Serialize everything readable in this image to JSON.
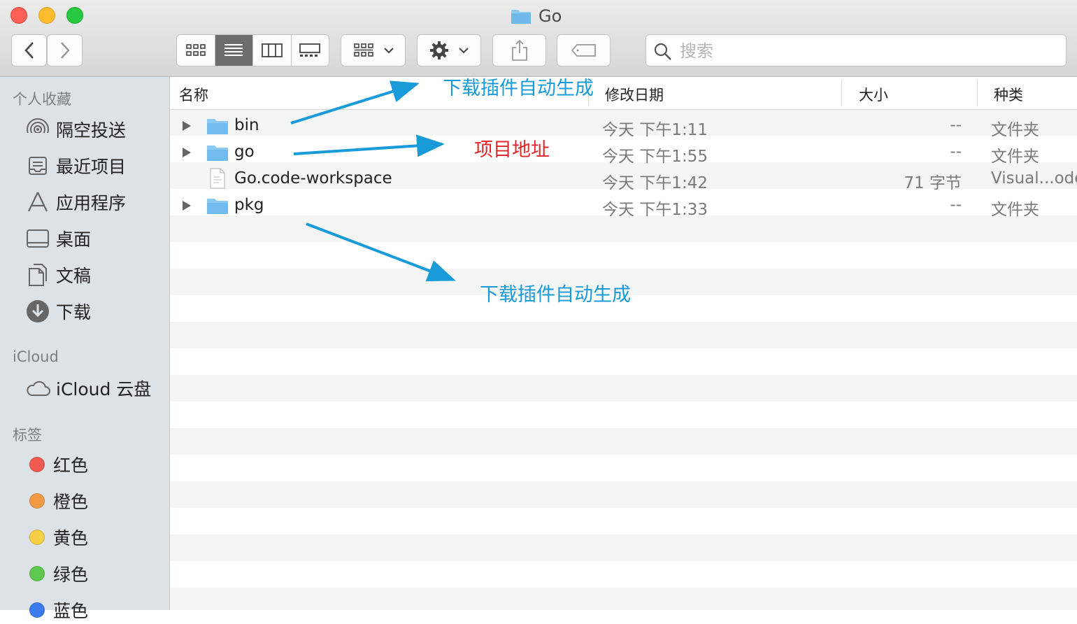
{
  "window": {
    "title": "Go"
  },
  "search": {
    "placeholder": "搜索"
  },
  "sidebar": {
    "favorites_header": "个人收藏",
    "favorites": [
      {
        "label": "隔空投送",
        "icon": "airdrop-icon"
      },
      {
        "label": "最近项目",
        "icon": "recents-icon"
      },
      {
        "label": "应用程序",
        "icon": "applications-icon"
      },
      {
        "label": "桌面",
        "icon": "desktop-icon"
      },
      {
        "label": "文稿",
        "icon": "documents-icon"
      },
      {
        "label": "下载",
        "icon": "downloads-icon"
      }
    ],
    "icloud_header": "iCloud",
    "icloud_items": [
      {
        "label": "iCloud 云盘",
        "icon": "cloud-icon"
      }
    ],
    "tags_header": "标签",
    "tags": [
      {
        "label": "红色",
        "color": "#ee5b4f"
      },
      {
        "label": "橙色",
        "color": "#f09a46"
      },
      {
        "label": "黄色",
        "color": "#f5cf48"
      },
      {
        "label": "绿色",
        "color": "#5fc94f"
      },
      {
        "label": "蓝色",
        "color": "#3d7cf0"
      }
    ]
  },
  "columns": {
    "name": "名称",
    "modified": "修改日期",
    "size": "大小",
    "kind": "种类"
  },
  "files": [
    {
      "name": "bin",
      "date": "今天 下午1:11",
      "size": "--",
      "kind": "文件夹",
      "type": "folder"
    },
    {
      "name": "go",
      "date": "今天 下午1:55",
      "size": "--",
      "kind": "文件夹",
      "type": "folder"
    },
    {
      "name": "Go.code-workspace",
      "date": "今天 下午1:42",
      "size": "71 字节",
      "kind": "Visual...ode",
      "type": "file"
    },
    {
      "name": "pkg",
      "date": "今天 下午1:33",
      "size": "--",
      "kind": "文件夹",
      "type": "folder"
    }
  ],
  "annotations": {
    "top_note": "下载插件自动生成",
    "middle_note": "项目地址",
    "bottom_note": "下载插件自动生成",
    "blue": "#1a9bd9",
    "red": "#e3262a"
  }
}
